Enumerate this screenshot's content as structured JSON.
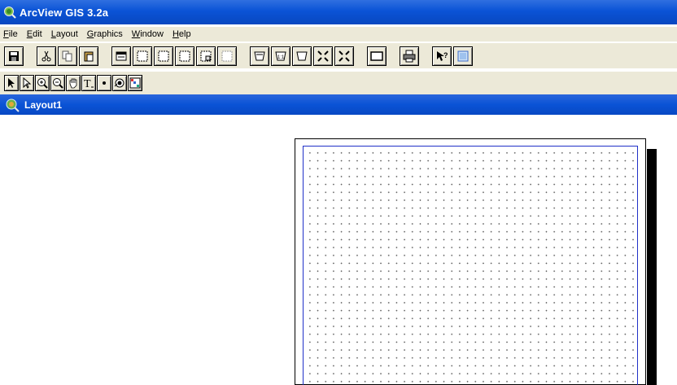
{
  "window": {
    "title": "ArcView GIS 3.2a",
    "icon": "arcview-globe-icon"
  },
  "menu": {
    "items": [
      {
        "label_first": "F",
        "label_rest": "ile"
      },
      {
        "label_first": "E",
        "label_rest": "dit"
      },
      {
        "label_first": "L",
        "label_rest": "ayout"
      },
      {
        "label_first": "G",
        "label_rest": "raphics"
      },
      {
        "label_first": "W",
        "label_rest": "indow"
      },
      {
        "label_first": "H",
        "label_rest": "elp"
      }
    ]
  },
  "toolbar_buttons": [
    "save-icon",
    "cut-icon",
    "copy-icon",
    "paste-icon",
    "properties-icon",
    "frame-icon",
    "frame-icon",
    "frame-icon",
    "frame-icon",
    "frame-icon",
    "zoom-full-icon",
    "zoom-page-icon",
    "zoom-actual-icon",
    "zoom-in-page-icon",
    "zoom-out-page-icon",
    "rectangle-icon",
    "print-icon",
    "help-icon",
    "layout-icon"
  ],
  "tool_buttons": [
    "pointer-icon",
    "vertex-icon",
    "zoom-in-icon",
    "zoom-out-icon",
    "pan-icon",
    "text-icon",
    "draw-point-icon",
    "frame-draw-icon",
    "grid-icon"
  ],
  "document": {
    "title": "Layout1"
  },
  "colors": {
    "titlebar": "#0a53d6",
    "chrome": "#ece9d8",
    "margin_line": "#2030c8"
  }
}
